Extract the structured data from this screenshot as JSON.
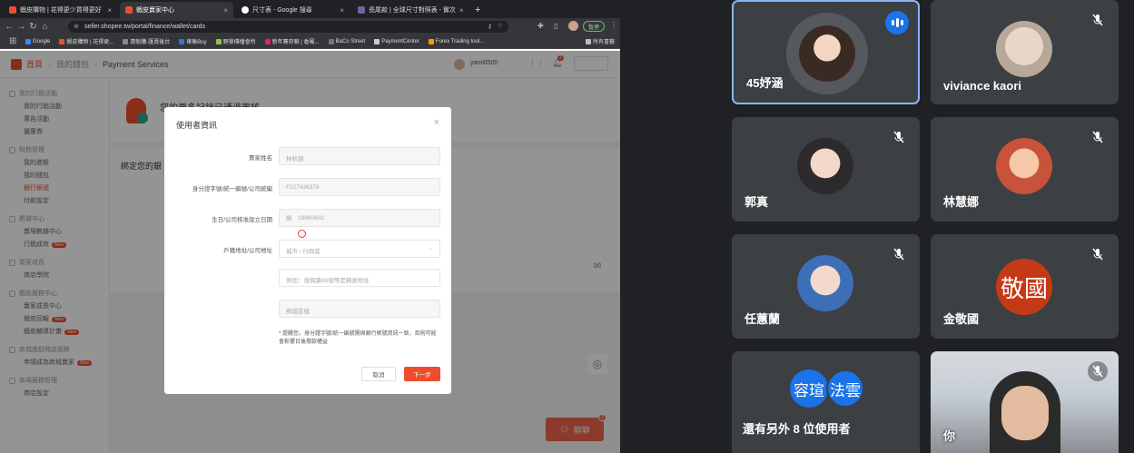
{
  "browser": {
    "tabs": [
      {
        "title": "蝦皮購物 | 花得更少買得更好",
        "color": "#ee4d2d"
      },
      {
        "title": "蝦皮賣家中心",
        "color": "#ee4d2d"
      },
      {
        "title": "尺寸表 - Google 搜尋",
        "color": "#4285f4"
      },
      {
        "title": "長尾款 | 全球尺寸對照表 - 實次",
        "color": "#7b5ea7"
      }
    ],
    "new_tab": "+",
    "url": "seller.shopee.tw/portal/finance/wallet/cards",
    "profile_label": "暫停",
    "bookmarks": [
      "Google",
      "蝦皮購物 | 花得更...",
      "惠魁購-匯賣後台",
      "華聯Buy",
      "野狼傳播會所",
      "新年賽奇嘛 | 香蜀...",
      "BaCo Street",
      "PaymentCenter",
      "Forex Trading tool...",
      "所有書籤"
    ]
  },
  "shopee": {
    "breadcrumb": [
      "首頁",
      "我的錢包",
      "Payment Services"
    ],
    "username": "yami0500",
    "notif_count": "3",
    "main_banner": "您的更多記錄已通過審核",
    "card_section_title": "綁定您的銀",
    "sidebar": [
      {
        "group": "我的行銷活動",
        "items": [
          "我的行銷活動",
          "廣告活動",
          "優惠券"
        ]
      },
      {
        "group": "財務管理",
        "items": [
          "我的進帳",
          "我的錢包",
          "銀行帳號",
          "付款設定"
        ],
        "active": 2
      },
      {
        "group": "數據中心",
        "items": [
          "賣場數據中心",
          "行銷成效"
        ],
        "badge_item": 1
      },
      {
        "group": "買家成長",
        "items": [
          "商店學院"
        ]
      },
      {
        "group": "蝦皮服務中心",
        "items": [
          "賣家成長中心",
          "蝦皮回報",
          "蝦皮輔導計畫"
        ],
        "badge_items": [
          1,
          2
        ]
      },
      {
        "group": "商城進駐開店服務",
        "items": [
          "申請成為商城賣家"
        ],
        "badge_item": 0
      },
      {
        "group": "商場服務管理",
        "items": [
          "商店設定"
        ]
      }
    ],
    "badge_new": "New",
    "chat_label": "聊聊",
    "chat_count": "1"
  },
  "modal": {
    "title": "使用者資訊",
    "fields": [
      {
        "label": "賣家姓名",
        "value": "林秋錦"
      },
      {
        "label": "身分證字號/統一編號/公司統編",
        "value": "F227436379"
      },
      {
        "label": "生日/公司核准設立日期",
        "value": "19860602"
      },
      {
        "label": "戶籍地址/公司地址",
        "value": "城市 / 行政區"
      },
      {
        "label": "",
        "value": "例如：復興路88號等是歸誰地址"
      },
      {
        "label": "",
        "value": "郵遞區號"
      }
    ],
    "note": "* 提醒您，身分證字號/統一編號需與銀行帳號資訊一致，否則可能會影響日後撥款權益",
    "cancel": "取消",
    "next": "下一步"
  },
  "meet": {
    "participants": [
      {
        "name": "45妤涵",
        "speaking": true
      },
      {
        "name": "viviance kaori",
        "speaking": false
      },
      {
        "name": "郭真",
        "speaking": false
      },
      {
        "name": "林慧娜",
        "speaking": false
      },
      {
        "name": "任蕙蘭",
        "speaking": false
      },
      {
        "name": "金敬國",
        "speaking": false,
        "initials": "敬國"
      },
      {
        "name": "還有另外 8 位使用者",
        "speaking": false,
        "minis": [
          "容瑄",
          "法雲"
        ]
      },
      {
        "name": "你",
        "speaking": false
      }
    ],
    "colors": {
      "speak": "#8ab4f8",
      "tile": "#3c4043",
      "initial_bg": "#c53a16",
      "mini_bg": "#1a73e8"
    }
  }
}
